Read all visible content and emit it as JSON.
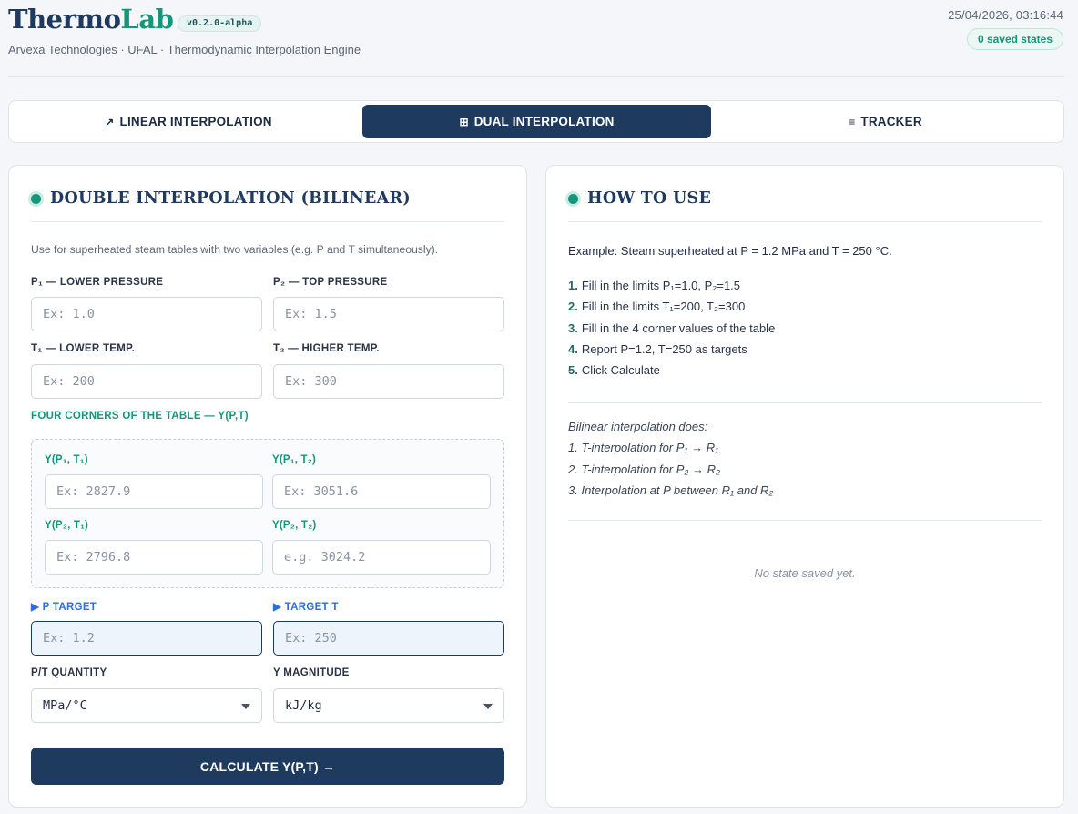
{
  "app": {
    "brand_part1": "Thermo",
    "brand_part2": "Lab",
    "version": "v0.2.0-alpha",
    "subtitle": "Arvexa Technologies · UFAL · Thermodynamic Interpolation Engine",
    "timestamp": "25/04/2026, 03:16:44",
    "saved_badge": "0 saved states"
  },
  "tabs": [
    {
      "icon": "↗",
      "label": "LINEAR INTERPOLATION",
      "active": false
    },
    {
      "icon": "⊞",
      "label": "DUAL INTERPOLATION",
      "active": true
    },
    {
      "icon": "≡",
      "label": "TRACKER",
      "active": false
    }
  ],
  "form": {
    "title": "DOUBLE INTERPOLATION (BILINEAR)",
    "description": "Use for superheated steam tables with two variables (e.g. P and T simultaneously).",
    "p1": {
      "label": "P₁ — LOWER PRESSURE",
      "placeholder": "Ex: 1.0",
      "value": ""
    },
    "p2": {
      "label": "P₂ — TOP PRESSURE",
      "placeholder": "Ex: 1.5",
      "value": ""
    },
    "t1": {
      "label": "T₁ — LOWER TEMP.",
      "placeholder": "Ex: 200",
      "value": ""
    },
    "t2": {
      "label": "T₂ — HIGHER TEMP.",
      "placeholder": "Ex: 300",
      "value": ""
    },
    "corners_title": "FOUR CORNERS OF THE TABLE — Y(P,T)",
    "y11": {
      "label": "Y(P₁, T₁)",
      "placeholder": "Ex: 2827.9",
      "value": ""
    },
    "y12": {
      "label": "Y(P₁, T₂)",
      "placeholder": "Ex: 3051.6",
      "value": ""
    },
    "y21": {
      "label": "Y(P₂, T₁)",
      "placeholder": "Ex: 2796.8",
      "value": ""
    },
    "y22": {
      "label": "Y(P₂, T₂)",
      "placeholder": "e.g. 3024.2",
      "value": ""
    },
    "p_target": {
      "label": "▶ P TARGET",
      "placeholder": "Ex: 1.2",
      "value": ""
    },
    "t_target": {
      "label": "▶ TARGET T",
      "placeholder": "Ex: 250",
      "value": ""
    },
    "pt_quantity": {
      "label": "P/T QUANTITY",
      "selected": "MPa/°C"
    },
    "y_magnitude": {
      "label": "Y MAGNITUDE",
      "selected": "kJ/kg"
    },
    "calculate_label": "CALCULATE Y(P,T) →"
  },
  "help": {
    "title": "HOW TO USE",
    "example": "Example: Steam superheated at P = 1.2 MPa and T = 250 °C.",
    "steps": [
      {
        "n": "1.",
        "text": "Fill in the limits P₁=1.0, P₂=1.5"
      },
      {
        "n": "2.",
        "text": "Fill in the limits T₁=200, T₂=300"
      },
      {
        "n": "3.",
        "text": "Fill in the 4 corner values of the table"
      },
      {
        "n": "4.",
        "text": "Report P=1.2, T=250 as targets"
      },
      {
        "n": "5.",
        "text": "Click Calculate"
      }
    ],
    "bilinear_lines": [
      "Bilinear interpolation does:",
      "1. T-interpolation for P₁ → R₁",
      "2. T-interpolation for P₂ → R₂",
      "3. Interpolation at P between R₁ and R₂"
    ],
    "empty_state": "No state saved yet."
  }
}
